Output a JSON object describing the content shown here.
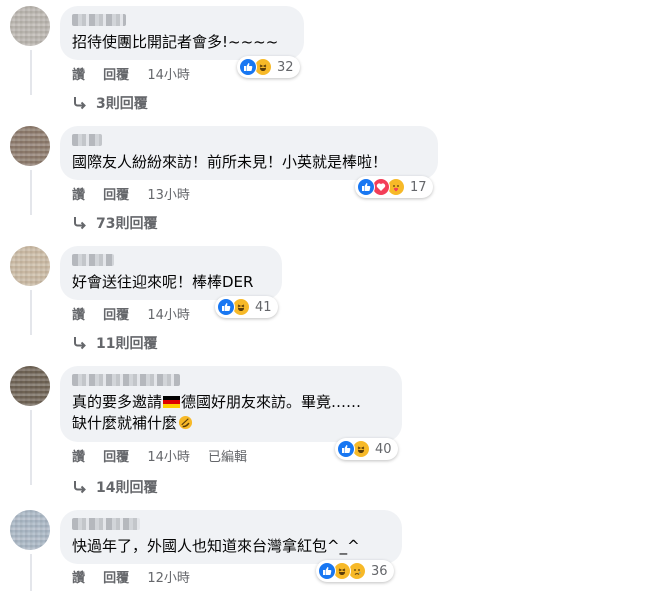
{
  "actions": {
    "like": "讚",
    "reply": "回覆",
    "edited": "已編輯"
  },
  "comments": [
    {
      "text": "招待使團比開記者會多!~~~~",
      "time": "14小時",
      "reactions": [
        "like",
        "haha"
      ],
      "reaction_count": "32",
      "replies_label": "3則回覆"
    },
    {
      "text": "國際友人紛紛來訪！前所未見！小英就是棒啦！",
      "time": "13小時",
      "reactions": [
        "like",
        "love",
        "care"
      ],
      "reaction_count": "17",
      "replies_label": "73則回覆"
    },
    {
      "text": "好會送往迎來呢！棒棒DER",
      "time": "14小時",
      "reactions": [
        "like",
        "haha"
      ],
      "reaction_count": "41",
      "replies_label": "11則回覆"
    },
    {
      "text_line1_a": "真的要多邀請",
      "text_line1_b": "德國好朋友來訪。畢竟……",
      "text_line2": "缺什麼就補什麼",
      "time": "14小時",
      "edited": true,
      "reactions": [
        "like",
        "haha"
      ],
      "reaction_count": "40",
      "replies_label": "14則回覆"
    },
    {
      "text": "快過年了，外國人也知道來台灣拿紅包^_^",
      "time": "12小時",
      "reactions": [
        "like",
        "haha",
        "sad"
      ],
      "reaction_count": "36"
    }
  ],
  "colors": {
    "bubble": "#f0f2f5",
    "meta": "#65676b",
    "like_blue": "#1877f2",
    "love_red": "#f33e58",
    "haha_yellow": "#f7b928"
  }
}
